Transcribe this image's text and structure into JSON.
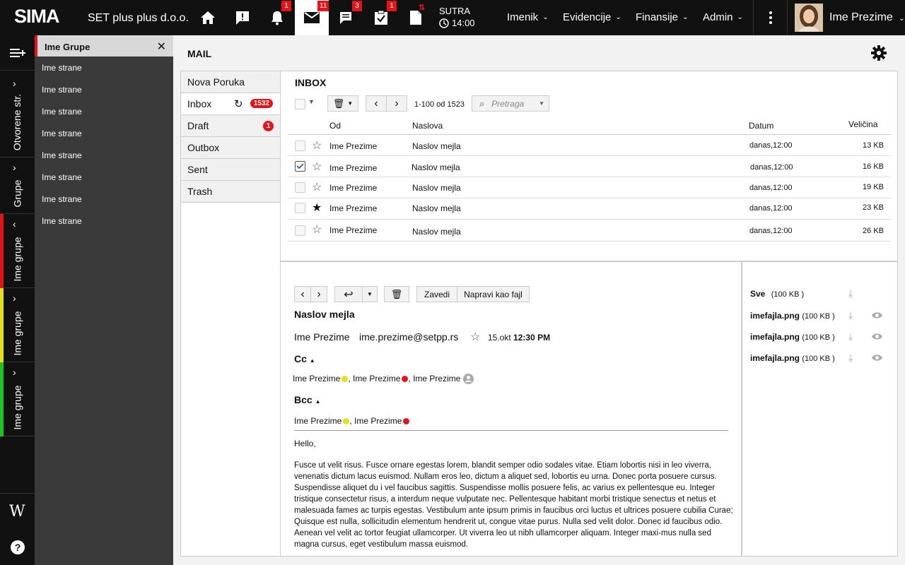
{
  "topbar": {
    "logo": "SIMA",
    "company": "SET plus plus d.o.o.",
    "badges": {
      "notifications": "1",
      "mail": "11",
      "chat": "3",
      "tasks": "1"
    },
    "sutra_label": "SUTRA",
    "sutra_time": "14:00",
    "menus": [
      "Imenik",
      "Evidencije",
      "Finansije",
      "Admin"
    ],
    "user": "Ime Prezime"
  },
  "rail": {
    "sections": [
      "Otvorene str.",
      "Grupe",
      "Ime grupe",
      "Ime grupe",
      "Ime grupe"
    ],
    "colors": {
      "red": "#e3141b",
      "yellow": "#e6e01a",
      "green": "#1ec41e"
    }
  },
  "pages": {
    "header": "Ime Grupe",
    "items": [
      "Ime strane",
      "Ime strane",
      "Ime strane",
      "Ime strane",
      "Ime strane",
      "Ime strane",
      "Ime strane",
      "Ime strane"
    ]
  },
  "mail": {
    "title": "MAIL",
    "folders": [
      {
        "label": "Nova Poruka",
        "badge": ""
      },
      {
        "label": "Inbox",
        "badge": "1532"
      },
      {
        "label": "Draft",
        "badge": "1"
      },
      {
        "label": "Outbox",
        "badge": ""
      },
      {
        "label": "Sent",
        "badge": ""
      },
      {
        "label": "Trash",
        "badge": ""
      }
    ],
    "list": {
      "title": "INBOX",
      "range": "1-100 od 1523",
      "search_placeholder": "Pretraga",
      "columns": {
        "from": "Od",
        "subject": "Naslova",
        "date": "Datum",
        "size": "Veličina"
      },
      "rows": [
        {
          "from": "Ime Prezime",
          "subject": "Naslov mejla",
          "date": "danas,12:00",
          "size": "13 KB",
          "checked": false,
          "starred": false
        },
        {
          "from": "Ime Prezime",
          "subject": "Naslov mejla",
          "date": "danas,12:00",
          "size": "16 KB",
          "checked": true,
          "starred": false
        },
        {
          "from": "Ime Prezime",
          "subject": "Naslov mejla",
          "date": "danas,12:00",
          "size": "19 KB",
          "checked": false,
          "starred": false
        },
        {
          "from": "Ime Prezime",
          "subject": "Naslov mejla",
          "date": "danas,12:00",
          "size": "23 KB",
          "checked": false,
          "starred": true
        },
        {
          "from": "Ime Prezime",
          "subject": "Naslov mejla",
          "date": "danas,12:00",
          "size": "26 KB",
          "checked": false,
          "starred": false
        }
      ]
    },
    "reader": {
      "btn_file": "Zavedi",
      "btn_save_as_file": "Napravi kao fajl",
      "subject": "Naslov mejla",
      "sender_name": "Ime Prezime",
      "sender_email": "ime.prezime@setpp.rs",
      "date": "15.okt",
      "time": "12:30 PM",
      "cc_label": "Cc",
      "cc": [
        "Ime Prezime",
        "Ime Prezime",
        "Ime Prezime"
      ],
      "bcc_label": "Bcc",
      "bcc": [
        "Ime Prezime",
        "Ime Prezime"
      ],
      "greeting": "Hello,",
      "body": "Fusce ut velit risus. Fusce ornare egestas lorem, blandit semper odio sodales vitae. Etiam lobortis nisi in leo viverra, venenatis dictum lacus euismod. Nullam eros leo, dictum a aliquet sed, lobortis eu urna. Donec porta posuere cursus. Suspendisse aliquet du i vel faucibus sagittis. Suspendisse mollis posuere felis, ac varius ex pellentesque eu. Integer tristique consectetur risus, a interdum neque vulputate nec. Pellentesque habitant morbi tristique senectus et netus et malesuada fames ac turpis egestas. Vestibulum ante ipsum primis in faucibus orci luctus et ultrices posuere cubilia Curae; Quisque est nulla, sollicitudin elementum hendrerit ut, congue vitae purus. Nulla sed velit dolor. Donec id faucibus odio. Aenean vel velit ac tortor feugiat ullamcorper. Ut viverra leo ut nibh ullamcorper aliquam. Integer maxi-mus nulla sed magna cursus, eget vestibulum massa euismod."
    },
    "attachments": [
      {
        "name": "Sve",
        "size": "(100 KB )",
        "preview": false
      },
      {
        "name": "imefajla.png",
        "size": "(100 KB )",
        "preview": true
      },
      {
        "name": "imefajla.png",
        "size": "(100 KB )",
        "preview": true
      },
      {
        "name": "imefajla.png",
        "size": "(100 KB )",
        "preview": true
      }
    ]
  }
}
